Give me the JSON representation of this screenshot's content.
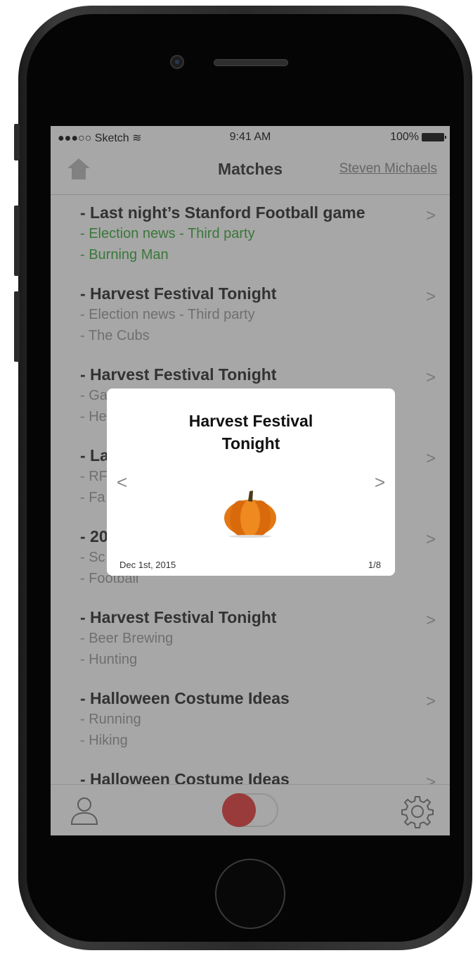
{
  "status_bar": {
    "carrier": "●●●○○ Sketch",
    "wifi": "wifi-icon",
    "time": "9:41 AM",
    "battery": "100%"
  },
  "navbar": {
    "title": "Matches",
    "user": "Steven Michaels",
    "home_icon": "home-icon"
  },
  "matches": [
    {
      "title": "- Last night’s Stanford Football game",
      "line2": "- Election news - Third party",
      "line3": "- Burning Man",
      "highlight": true
    },
    {
      "title": "- Harvest Festival Tonight",
      "line2": "- Election news - Third party",
      "line3": "- The Cubs"
    },
    {
      "title": "- Harvest Festival Tonight",
      "line2": "- Ga",
      "line3": "- He"
    },
    {
      "title": "- La",
      "line2": "- RF",
      "line3": "- Fa"
    },
    {
      "title": "- 20",
      "line2": "- Sc",
      "line3": "- Football"
    },
    {
      "title": "- Harvest Festival Tonight",
      "line2": "- Beer Brewing",
      "line3": "- Hunting"
    },
    {
      "title": "- Halloween Costume Ideas",
      "line2": "- Running",
      "line3": "- Hiking"
    },
    {
      "title": "- Halloween Costume Ideas",
      "line2": "",
      "line3": ""
    }
  ],
  "chevron": ">",
  "modal": {
    "title": "Harvest Festival Tonight",
    "prev": "<",
    "next": ">",
    "image": "pumpkin-image",
    "date": "Dec 1st, 2015",
    "page": "1/8"
  },
  "tabbar": {
    "left_icon": "user-icon",
    "center": "record-toggle",
    "right_icon": "gear-icon"
  },
  "colors": {
    "highlight_green": "#3aa83a",
    "toggle_red": "#e53b3b"
  }
}
